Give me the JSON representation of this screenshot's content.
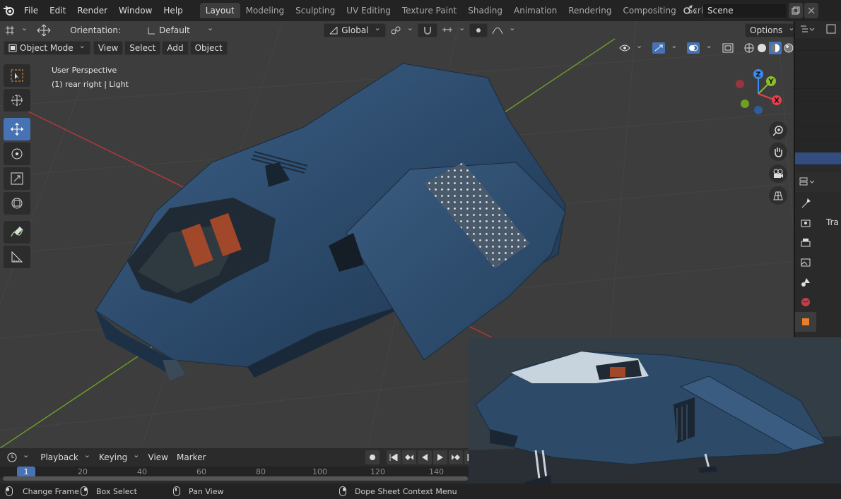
{
  "menu": {
    "items": [
      "File",
      "Edit",
      "Render",
      "Window",
      "Help"
    ]
  },
  "workspaces": {
    "tabs": [
      "Layout",
      "Modeling",
      "Sculpting",
      "UV Editing",
      "Texture Paint",
      "Shading",
      "Animation",
      "Rendering",
      "Compositing",
      "Scripting"
    ],
    "active": "Layout"
  },
  "scene": {
    "name": "Scene"
  },
  "viewport": {
    "orientation_label": "Orientation:",
    "orientation_value": "Default",
    "transform_space": "Global",
    "options_label": "Options",
    "mode": "Object Mode",
    "menus": [
      "View",
      "Select",
      "Add",
      "Object"
    ],
    "info_line1": "User Perspective",
    "info_line2": "(1) rear right | Light",
    "gizmo_axes": {
      "z": "Z",
      "y": "Y",
      "x": "X"
    }
  },
  "properties": {
    "partial_label": "Tra"
  },
  "timeline": {
    "menus": [
      "Playback",
      "Keying",
      "View",
      "Marker"
    ],
    "current_frame": "1",
    "ruler": [
      "20",
      "40",
      "60",
      "80",
      "100",
      "120",
      "140"
    ]
  },
  "status": {
    "change_frame": "Change Frame",
    "box_select": "Box Select",
    "pan_view": "Pan View",
    "context_menu": "Dope Sheet Context Menu"
  },
  "colors": {
    "accent": "#4772b3",
    "axis_x": "#e5414f",
    "axis_y": "#8bbf2a",
    "axis_z": "#3b8cf0",
    "ship_body": "#2c4a6b"
  }
}
